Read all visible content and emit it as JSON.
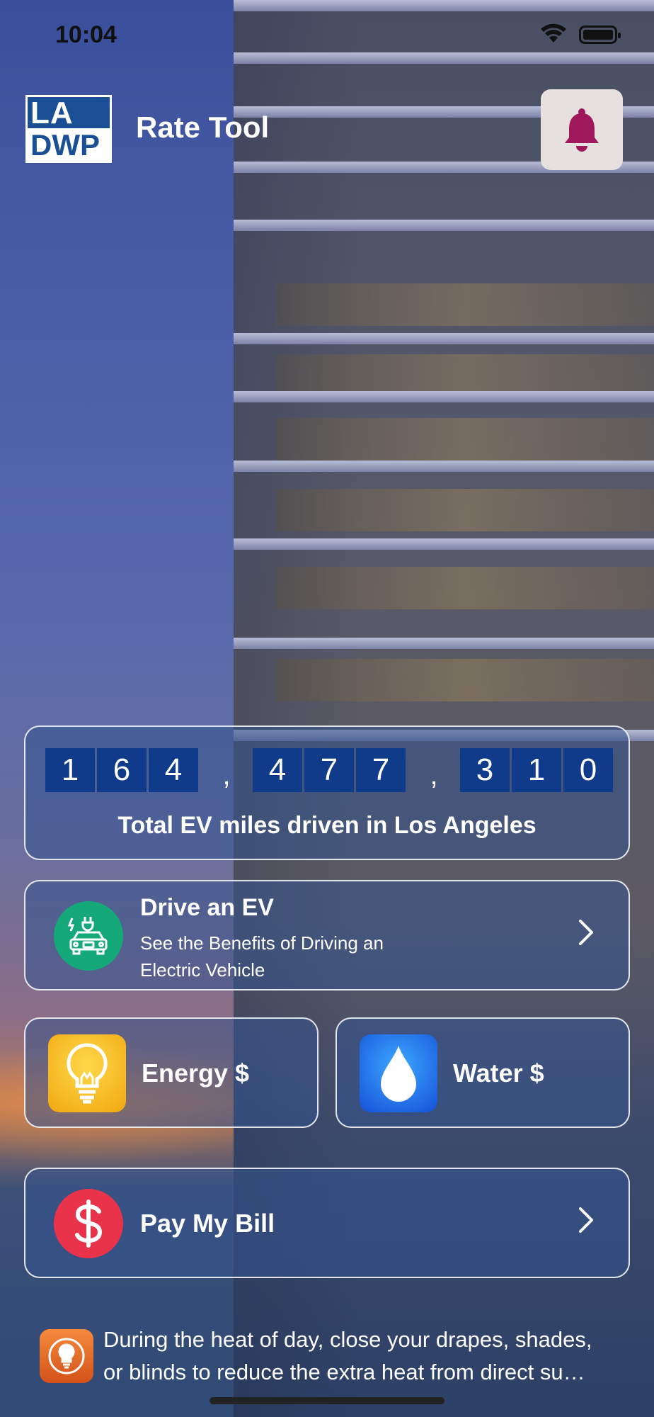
{
  "status_bar": {
    "time": "10:04"
  },
  "header": {
    "logo_top": "LA",
    "logo_bottom": "DWP",
    "title": "Rate Tool"
  },
  "ev_counter": {
    "digits": [
      "1",
      "6",
      "4",
      "4",
      "7",
      "7",
      "3",
      "1",
      "0"
    ],
    "separator": ",",
    "caption": "Total EV miles driven in Los Angeles"
  },
  "drive_ev": {
    "title": "Drive an EV",
    "subtitle_line1": "See the Benefits of Driving an",
    "subtitle_line2": "Electric Vehicle"
  },
  "energy": {
    "label": "Energy $"
  },
  "water": {
    "label": "Water $"
  },
  "bill": {
    "label": "Pay My Bill"
  },
  "tip": {
    "line1": "During the heat of day, close your drapes, shades,",
    "line2": "or blinds to reduce the extra heat from direct su…"
  },
  "colors": {
    "bell": "#a0185c",
    "ev_green": "#15a879",
    "bill_red": "#e8334a",
    "digit_bg": "#0f3b8a"
  }
}
